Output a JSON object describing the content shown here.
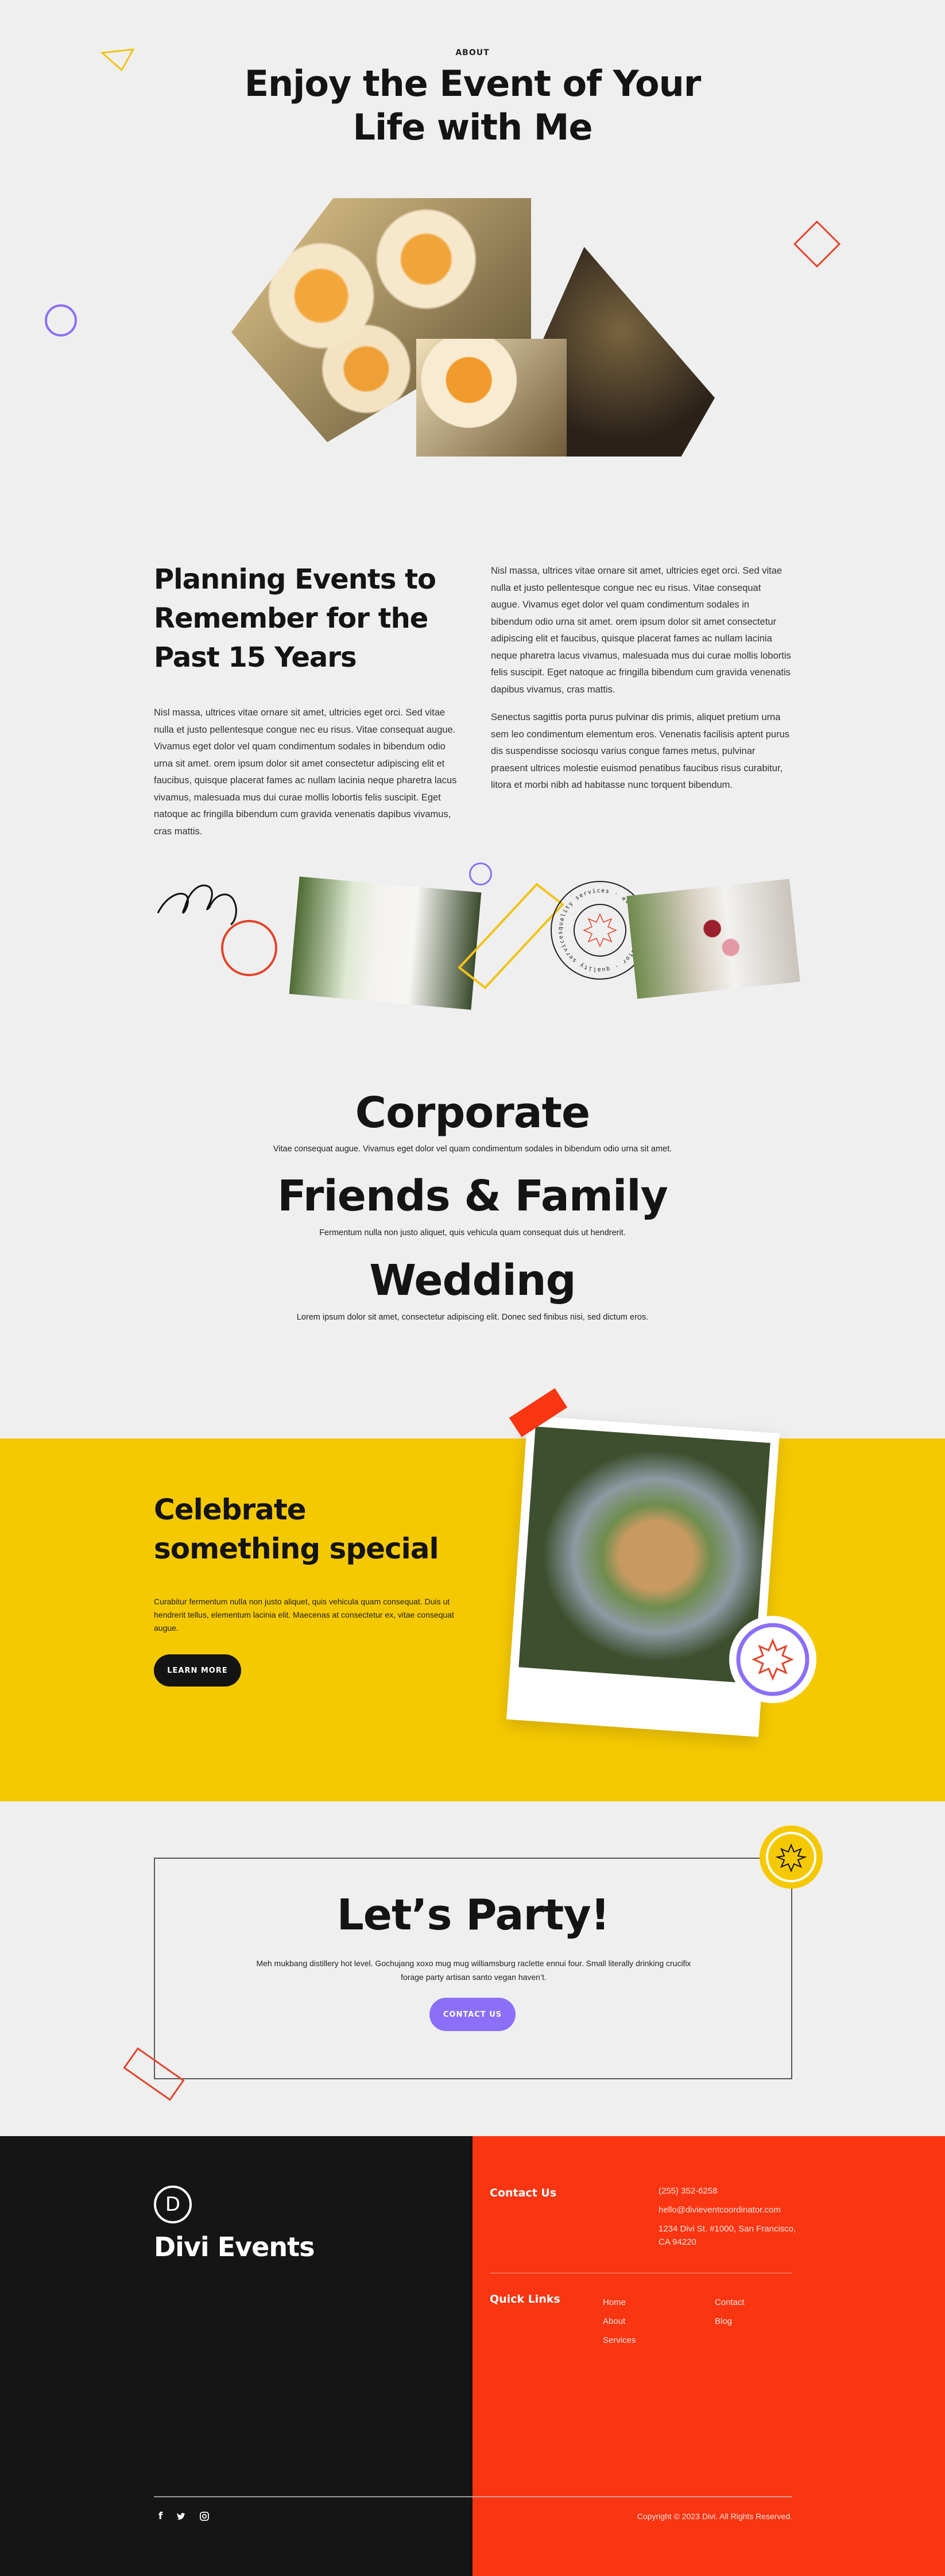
{
  "about": {
    "eyebrow": "ABOUT",
    "title_line1": "Enjoy the Event of Your",
    "title_line2": "Life with Me"
  },
  "intro": {
    "heading_lines": [
      "Planning Events to",
      "Remember for the",
      "Past 15 Years"
    ],
    "left_paragraph": "Nisl massa, ultrices vitae ornare sit amet, ultricies eget orci. Sed vitae nulla et justo pellentesque congue nec eu risus. Vitae consequat augue. Vivamus eget dolor vel quam condimentum sodales in bibendum odio urna sit amet. orem ipsum dolor sit amet consectetur adipiscing elit et faucibus, quisque placerat fames ac nullam lacinia neque pharetra lacus vivamus, malesuada mus dui curae mollis lobortis felis suscipit. Eget natoque ac fringilla bibendum cum gravida venenatis dapibus vivamus, cras mattis.",
    "right_paragraph_1": "Nisl massa, ultrices vitae ornare sit amet, ultricies eget orci. Sed vitae nulla et justo pellentesque congue nec eu risus. Vitae consequat augue. Vivamus eget dolor vel quam condimentum sodales in bibendum odio urna sit amet. orem ipsum dolor sit amet consectetur adipiscing elit et faucibus, quisque placerat fames ac nullam lacinia neque pharetra lacus vivamus, malesuada mus dui curae mollis lobortis felis suscipit. Eget natoque ac fringilla bibendum cum gravida venenatis dapibus vivamus, cras mattis.",
    "right_paragraph_2": "Senectus sagittis porta purus pulvinar dis primis, aliquet pretium urna sem leo condimentum elementum eros. Venenatis facilisis aptent purus dis suspendisse sociosqu varius congue fames metus, pulvinar praesent ultrices molestie euismod penatibus faucibus risus curabitur, litora et morbi nibh ad habitasse nunc torquent bibendum.",
    "stamp_text": "quality services · event coordinator · quality services · event coordinator ·"
  },
  "services": [
    {
      "title": "Corporate",
      "description": "Vitae consequat augue. Vivamus eget dolor vel quam condimentum sodales in bibendum odio urna sit amet."
    },
    {
      "title": "Friends & Family",
      "description": "Fermentum nulla non justo aliquet, quis vehicula quam consequat duis ut hendrerit."
    },
    {
      "title": "Wedding",
      "description": "Lorem ipsum dolor sit amet, consectetur adipiscing elit. Donec sed finibus nisi, sed dictum eros."
    }
  ],
  "celebrate": {
    "heading_line1": "Celebrate",
    "heading_line2": "something special",
    "paragraph": "Curabitur fermentum nulla non justo aliquet, quis vehicula quam consequat. Duis ut hendrerit tellus, elementum lacinia elit. Maecenas at consectetur ex, vitae consequat augue.",
    "button": "LEARN MORE"
  },
  "party": {
    "heading": "Let’s Party!",
    "paragraph": "Meh mukbang distillery hot level. Gochujang xoxo mug mug williamsburg raclette ennui four. Small literally drinking crucifix forage party artisan santo vegan haven’t.",
    "button": "CONTACT US"
  },
  "footer": {
    "logo_letter": "D",
    "brand": "Divi Events",
    "contact_heading": "Contact Us",
    "phone": "(255) 352-6258",
    "email": "hello@divieventcoordinator.com",
    "address_line1": "1234 Divi St. #1000, San Francisco,",
    "address_line2": "CA 94220",
    "links_heading": "Quick Links",
    "links_col1": [
      "Home",
      "About",
      "Services"
    ],
    "links_col2": [
      "Contact",
      "Blog"
    ],
    "social": [
      "facebook-icon",
      "twitter-icon",
      "instagram-icon"
    ],
    "copyright": "Copyright © 2023 Divi. All Rights Reserved."
  },
  "colors": {
    "yellow": "#f5c902",
    "red": "#f93512",
    "purple": "#8b6ff7",
    "dark": "#151515",
    "background": "#f0efef"
  }
}
